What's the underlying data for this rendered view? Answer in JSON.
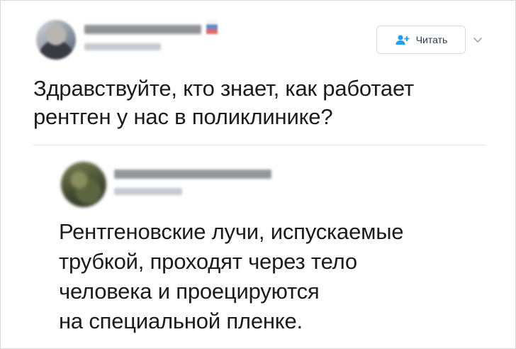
{
  "tweet": {
    "author": {
      "avatar_icon": "blurred-avatar",
      "flag_icon": "flag-icon"
    },
    "follow_button": {
      "label": "Читать",
      "icon": "add-user-icon"
    },
    "menu_icon": "chevron-down-icon",
    "text_lines": [
      "Здравствуйте, кто знает, как работает",
      "рентген у нас в поликлинике?"
    ]
  },
  "reply": {
    "author": {
      "avatar_icon": "blurred-avatar"
    },
    "text_lines": [
      "Рентгеновские лучи, испускаемые",
      "трубкой, проходят через тело",
      "человека и проецируются",
      "на специальной пленке."
    ]
  },
  "colors": {
    "text": "#1b1b1b",
    "accent": "#1da1f2",
    "divider": "#e3e6e9",
    "button_border": "#d5dde4"
  }
}
